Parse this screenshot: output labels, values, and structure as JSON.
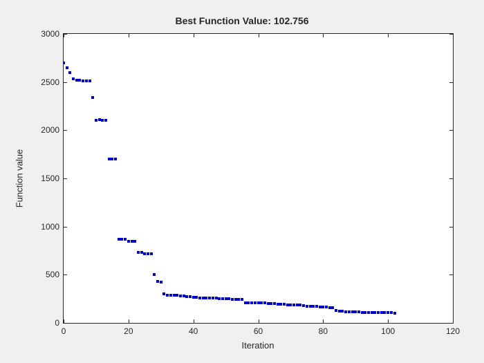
{
  "chart_data": {
    "type": "scatter",
    "title": "Best Function Value: 102.756",
    "xlabel": "Iteration",
    "ylabel": "Function value",
    "xlim": [
      0,
      120
    ],
    "ylim": [
      0,
      3000
    ],
    "xticks": [
      0,
      20,
      40,
      60,
      80,
      100,
      120
    ],
    "yticks": [
      0,
      500,
      1000,
      1500,
      2000,
      2500,
      3000
    ],
    "x": [
      0,
      1,
      2,
      3,
      4,
      5,
      6,
      7,
      8,
      9,
      10,
      11,
      12,
      13,
      14,
      15,
      16,
      17,
      18,
      19,
      20,
      21,
      22,
      23,
      24,
      25,
      26,
      27,
      28,
      29,
      30,
      31,
      32,
      33,
      34,
      35,
      36,
      37,
      38,
      39,
      40,
      41,
      42,
      43,
      44,
      45,
      46,
      47,
      48,
      49,
      50,
      51,
      52,
      53,
      54,
      55,
      56,
      57,
      58,
      59,
      60,
      61,
      62,
      63,
      64,
      65,
      66,
      67,
      68,
      69,
      70,
      71,
      72,
      73,
      74,
      75,
      76,
      77,
      78,
      79,
      80,
      81,
      82,
      83,
      84,
      85,
      86,
      87,
      88,
      89,
      90,
      91,
      92,
      93,
      94,
      95,
      96,
      97,
      98,
      99,
      100,
      101,
      102
    ],
    "values": [
      2700,
      2650,
      2600,
      2530,
      2520,
      2520,
      2510,
      2510,
      2510,
      2340,
      2100,
      2110,
      2100,
      2100,
      1700,
      1700,
      1700,
      870,
      870,
      870,
      850,
      850,
      850,
      730,
      730,
      720,
      720,
      720,
      500,
      430,
      420,
      300,
      290,
      290,
      290,
      285,
      280,
      280,
      275,
      270,
      265,
      265,
      260,
      260,
      260,
      255,
      255,
      255,
      250,
      250,
      250,
      250,
      245,
      245,
      245,
      245,
      210,
      210,
      210,
      210,
      210,
      210,
      210,
      200,
      200,
      200,
      195,
      195,
      195,
      190,
      190,
      190,
      185,
      185,
      180,
      175,
      175,
      175,
      170,
      165,
      165,
      165,
      160,
      160,
      130,
      125,
      120,
      115,
      115,
      115,
      115,
      115,
      110,
      110,
      110,
      110,
      110,
      110,
      105,
      105,
      105,
      105,
      103
    ]
  }
}
